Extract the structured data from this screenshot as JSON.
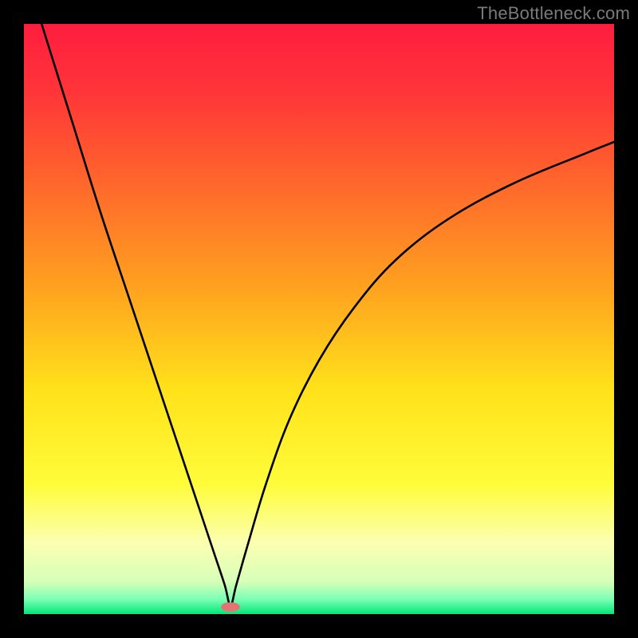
{
  "watermark": "TheBottleneck.com",
  "chart_data": {
    "type": "line",
    "title": "",
    "xlabel": "",
    "ylabel": "",
    "xlim": [
      0,
      100
    ],
    "ylim": [
      0,
      100
    ],
    "background_gradient_stops": [
      {
        "offset": 0.0,
        "color": "#ff1d3f"
      },
      {
        "offset": 0.12,
        "color": "#ff3638"
      },
      {
        "offset": 0.28,
        "color": "#ff6a2b"
      },
      {
        "offset": 0.45,
        "color": "#ffa31f"
      },
      {
        "offset": 0.62,
        "color": "#ffe21a"
      },
      {
        "offset": 0.78,
        "color": "#fffc3a"
      },
      {
        "offset": 0.88,
        "color": "#fbffb2"
      },
      {
        "offset": 0.945,
        "color": "#d7ffb8"
      },
      {
        "offset": 0.975,
        "color": "#7bffb6"
      },
      {
        "offset": 1.0,
        "color": "#00e676"
      }
    ],
    "series": [
      {
        "name": "bottleneck-curve",
        "note": "Approximate V-shaped curve; y estimated from vertical position (0=top, 100=bottom). Minimum (apex) at x≈35.",
        "x": [
          3.0,
          8.0,
          13.0,
          18.0,
          23.0,
          28.0,
          32.0,
          34.0,
          35.0,
          36.0,
          38.0,
          41.0,
          45.0,
          50.0,
          56.0,
          63.0,
          72.0,
          83.0,
          95.0,
          100.0
        ],
        "y": [
          0.0,
          16.0,
          32.0,
          47.0,
          62.0,
          77.0,
          89.0,
          95.0,
          98.5,
          95.0,
          88.0,
          78.0,
          67.0,
          57.0,
          48.0,
          40.0,
          33.0,
          27.0,
          22.0,
          20.0
        ]
      }
    ],
    "marker": {
      "name": "apex-marker",
      "x": 35.0,
      "y": 98.8,
      "color": "#e57373",
      "rx": 1.6,
      "ry": 0.8
    }
  }
}
